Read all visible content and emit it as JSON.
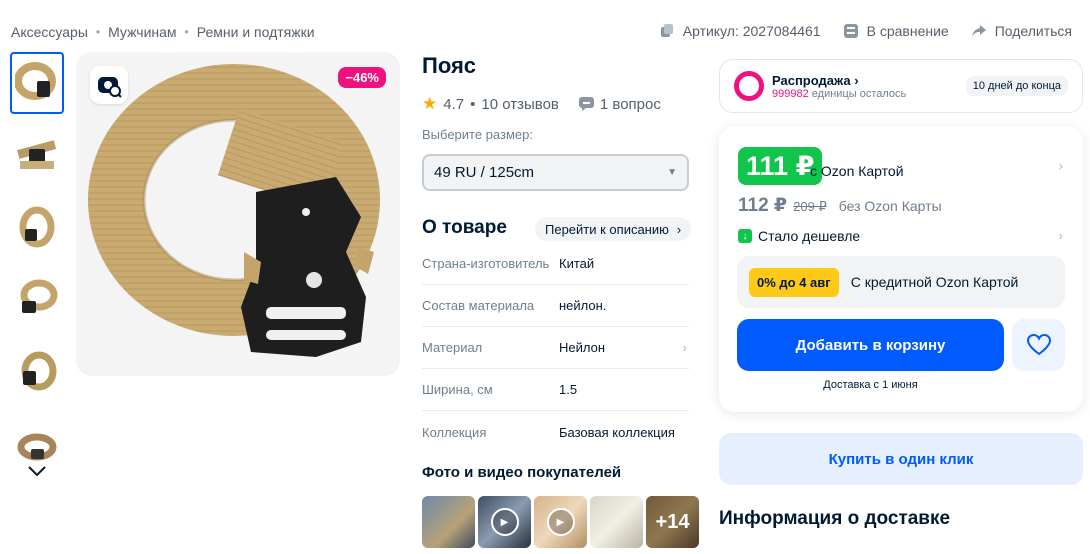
{
  "breadcrumb": [
    "Аксессуары",
    "Мужчинам",
    "Ремни и подтяжки"
  ],
  "top_actions": {
    "article": "Артикул: 2027084461",
    "compare": "В сравнение",
    "share": "Поделиться"
  },
  "gallery": {
    "discount": "−46%",
    "thumbnail_count": 6
  },
  "product": {
    "title": "Пояс",
    "rating": "4.7",
    "reviews": "10 отзывов",
    "questions": "1 вопрос",
    "size_label": "Выберите размер:",
    "size_value": "49 RU / 125cm"
  },
  "about": {
    "title": "О товаре",
    "to_description": "Перейти к описанию",
    "specs": [
      {
        "key": "Страна-изготовитель",
        "value": "Китай"
      },
      {
        "key": "Состав материала",
        "value": "нейлон."
      },
      {
        "key": "Материал",
        "value": "Нейлон"
      },
      {
        "key": "Ширина, см",
        "value": "1.5"
      },
      {
        "key": "Коллекция",
        "value": "Базовая коллекция"
      }
    ]
  },
  "customer_photos": {
    "title": "Фото и видео покупателей",
    "more": "+14"
  },
  "sale": {
    "title": "Распродажа",
    "count": "999982",
    "count_suffix": "единицы осталось",
    "days_left": "10 дней до конца"
  },
  "price": {
    "ozon_price": "111 ₽",
    "ozon_note": "с Ozon Картой",
    "regular_price": "112 ₽",
    "old_price": "209 ₽",
    "regular_note": "без Ozon Карты",
    "cheaper": "Стало дешевле",
    "credit_badge": "0% до 4 авг",
    "credit_text": "С кредитной Ozon Картой",
    "add_to_cart": "Добавить в корзину",
    "delivery": "Доставка с 1 июня"
  },
  "buy_one_click": "Купить в один клик",
  "delivery_info_title": "Информация о доставке",
  "colors": {
    "accent": "#005bff",
    "sale_pink": "#f1117e",
    "ozon_green": "#10c44c",
    "credit_yellow": "#ffc918",
    "belt_tan": "#c4a46a"
  }
}
